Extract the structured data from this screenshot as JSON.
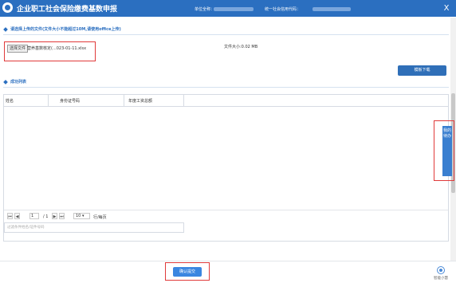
{
  "header": {
    "title": "企业职工社会保险缴费基数申报",
    "unit_name_label": "单位全称：",
    "credit_code_label": "统一社会信用代码：",
    "close_glyph": "X"
  },
  "upload_section": {
    "heading": "请选择上传的文件(文件大小不能超过10M,请使用office上传)",
    "choose_button": "选择文件",
    "file_name": "营养基数核定(...023-01-11.xlsx",
    "file_size": "文件大小:0.02 MB",
    "template_button": "模板下载"
  },
  "success_section": {
    "heading": "成功列表"
  },
  "table": {
    "columns": [
      "姓名",
      "身份证号码",
      "年度工资总额"
    ]
  },
  "pager": {
    "first": "⏮",
    "prev": "◀",
    "current_page": "1",
    "total_pages": "/ 1",
    "next": "▶",
    "last": "⏭",
    "page_size": "10",
    "page_size_label": "行/每页"
  },
  "filter": {
    "placeholder": "过滤条件姓名/证件号码"
  },
  "footer": {
    "confirm_button": "确认提交",
    "smart_assistant": "智能小慧"
  },
  "side_tab": {
    "label": "我的待办"
  },
  "colors": {
    "title_bar": "#2b6fc0",
    "section_heading": "#2b6fc0",
    "primary_button": "#3a86e0",
    "highlight_box": "#e03a3a"
  }
}
